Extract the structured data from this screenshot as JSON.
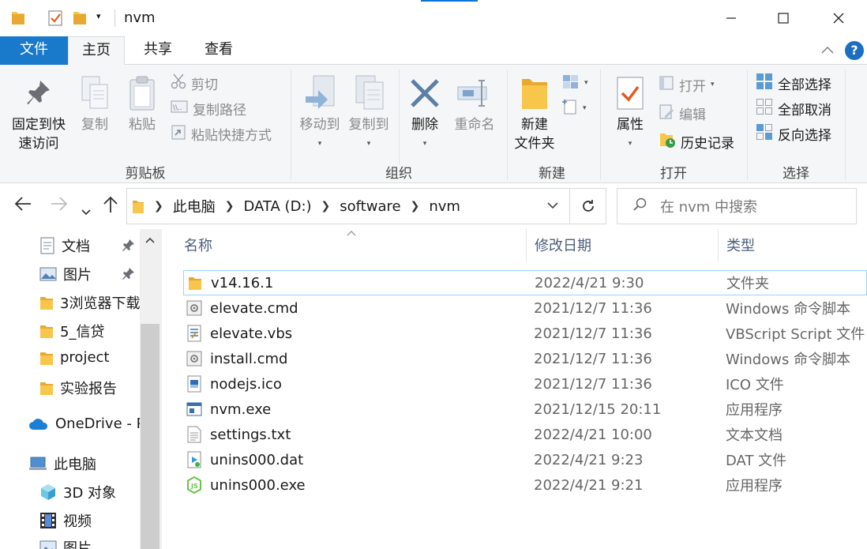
{
  "window": {
    "title": "nvm",
    "minimize_symbol": "—",
    "maximize_symbol": "☐",
    "close_symbol": "✕"
  },
  "ribbon_tabs": {
    "file": "文件",
    "home": "主页",
    "share": "共享",
    "view": "查看"
  },
  "ribbon": {
    "clipboard": {
      "label": "剪贴板",
      "pin": "固定到快\n速访问",
      "pin_l1": "固定到快",
      "pin_l2": "速访问",
      "copy": "复制",
      "paste": "粘贴",
      "cut": "剪切",
      "copy_path": "复制路径",
      "paste_shortcut": "粘贴快捷方式"
    },
    "organize": {
      "label": "组织",
      "move_to": "移动到",
      "copy_to": "复制到",
      "delete": "删除",
      "rename": "重命名"
    },
    "new": {
      "label": "新建",
      "new_folder_l1": "新建",
      "new_folder_l2": "文件夹"
    },
    "open": {
      "label": "打开",
      "properties": "属性",
      "open": "打开",
      "edit": "编辑",
      "history": "历史记录"
    },
    "select": {
      "label": "选择",
      "select_all": "全部选择",
      "select_none": "全部取消",
      "invert": "反向选择"
    }
  },
  "address": {
    "crumbs": [
      "此电脑",
      "DATA (D:)",
      "software",
      "nvm"
    ],
    "search_placeholder": "在 nvm 中搜索"
  },
  "nav_pane": {
    "items": [
      {
        "label": "文档",
        "icon": "document-icon",
        "pinned": true
      },
      {
        "label": "图片",
        "icon": "pictures-icon",
        "pinned": true
      },
      {
        "label": "3浏览器下载",
        "icon": "folder-icon",
        "pinned": false
      },
      {
        "label": "5_信贷",
        "icon": "folder-icon",
        "pinned": false
      },
      {
        "label": "project",
        "icon": "folder-icon",
        "pinned": false
      },
      {
        "label": "实验报告",
        "icon": "folder-icon",
        "pinned": false
      },
      {
        "label": "OneDrive - P",
        "icon": "onedrive-icon",
        "pinned": false
      },
      {
        "label": "此电脑",
        "icon": "computer-icon",
        "pinned": false
      },
      {
        "label": "3D 对象",
        "icon": "3d-objects-icon",
        "pinned": false
      },
      {
        "label": "视频",
        "icon": "video-icon",
        "pinned": false
      },
      {
        "label": "图片",
        "icon": "pictures-icon",
        "pinned": false
      }
    ]
  },
  "columns": {
    "name": "名称",
    "date": "修改日期",
    "type": "类型"
  },
  "files": [
    {
      "name": "v14.16.1",
      "date": "2022/4/21 9:30",
      "type": "文件夹",
      "icon": "folder-icon"
    },
    {
      "name": "elevate.cmd",
      "date": "2021/12/7 11:36",
      "type": "Windows 命令脚本",
      "icon": "cmd-file-icon"
    },
    {
      "name": "elevate.vbs",
      "date": "2021/12/7 11:36",
      "type": "VBScript Script 文件",
      "icon": "vbs-file-icon"
    },
    {
      "name": "install.cmd",
      "date": "2021/12/7 11:36",
      "type": "Windows 命令脚本",
      "icon": "cmd-file-icon"
    },
    {
      "name": "nodejs.ico",
      "date": "2021/12/7 11:36",
      "type": "ICO 文件",
      "icon": "ico-file-icon"
    },
    {
      "name": "nvm.exe",
      "date": "2021/12/15 20:11",
      "type": "应用程序",
      "icon": "exe-file-icon"
    },
    {
      "name": "settings.txt",
      "date": "2022/4/21 10:00",
      "type": "文本文档",
      "icon": "text-file-icon"
    },
    {
      "name": "unins000.dat",
      "date": "2022/4/21 9:23",
      "type": "DAT 文件",
      "icon": "dat-file-icon"
    },
    {
      "name": "unins000.exe",
      "date": "2022/4/21 9:21",
      "type": "应用程序",
      "icon": "nodejs-exe-icon"
    }
  ],
  "colors": {
    "file_tab": "#1979ca",
    "folder": "#f8c64a",
    "selection_border": "#99d1ff",
    "help": "#1b6ec2"
  }
}
